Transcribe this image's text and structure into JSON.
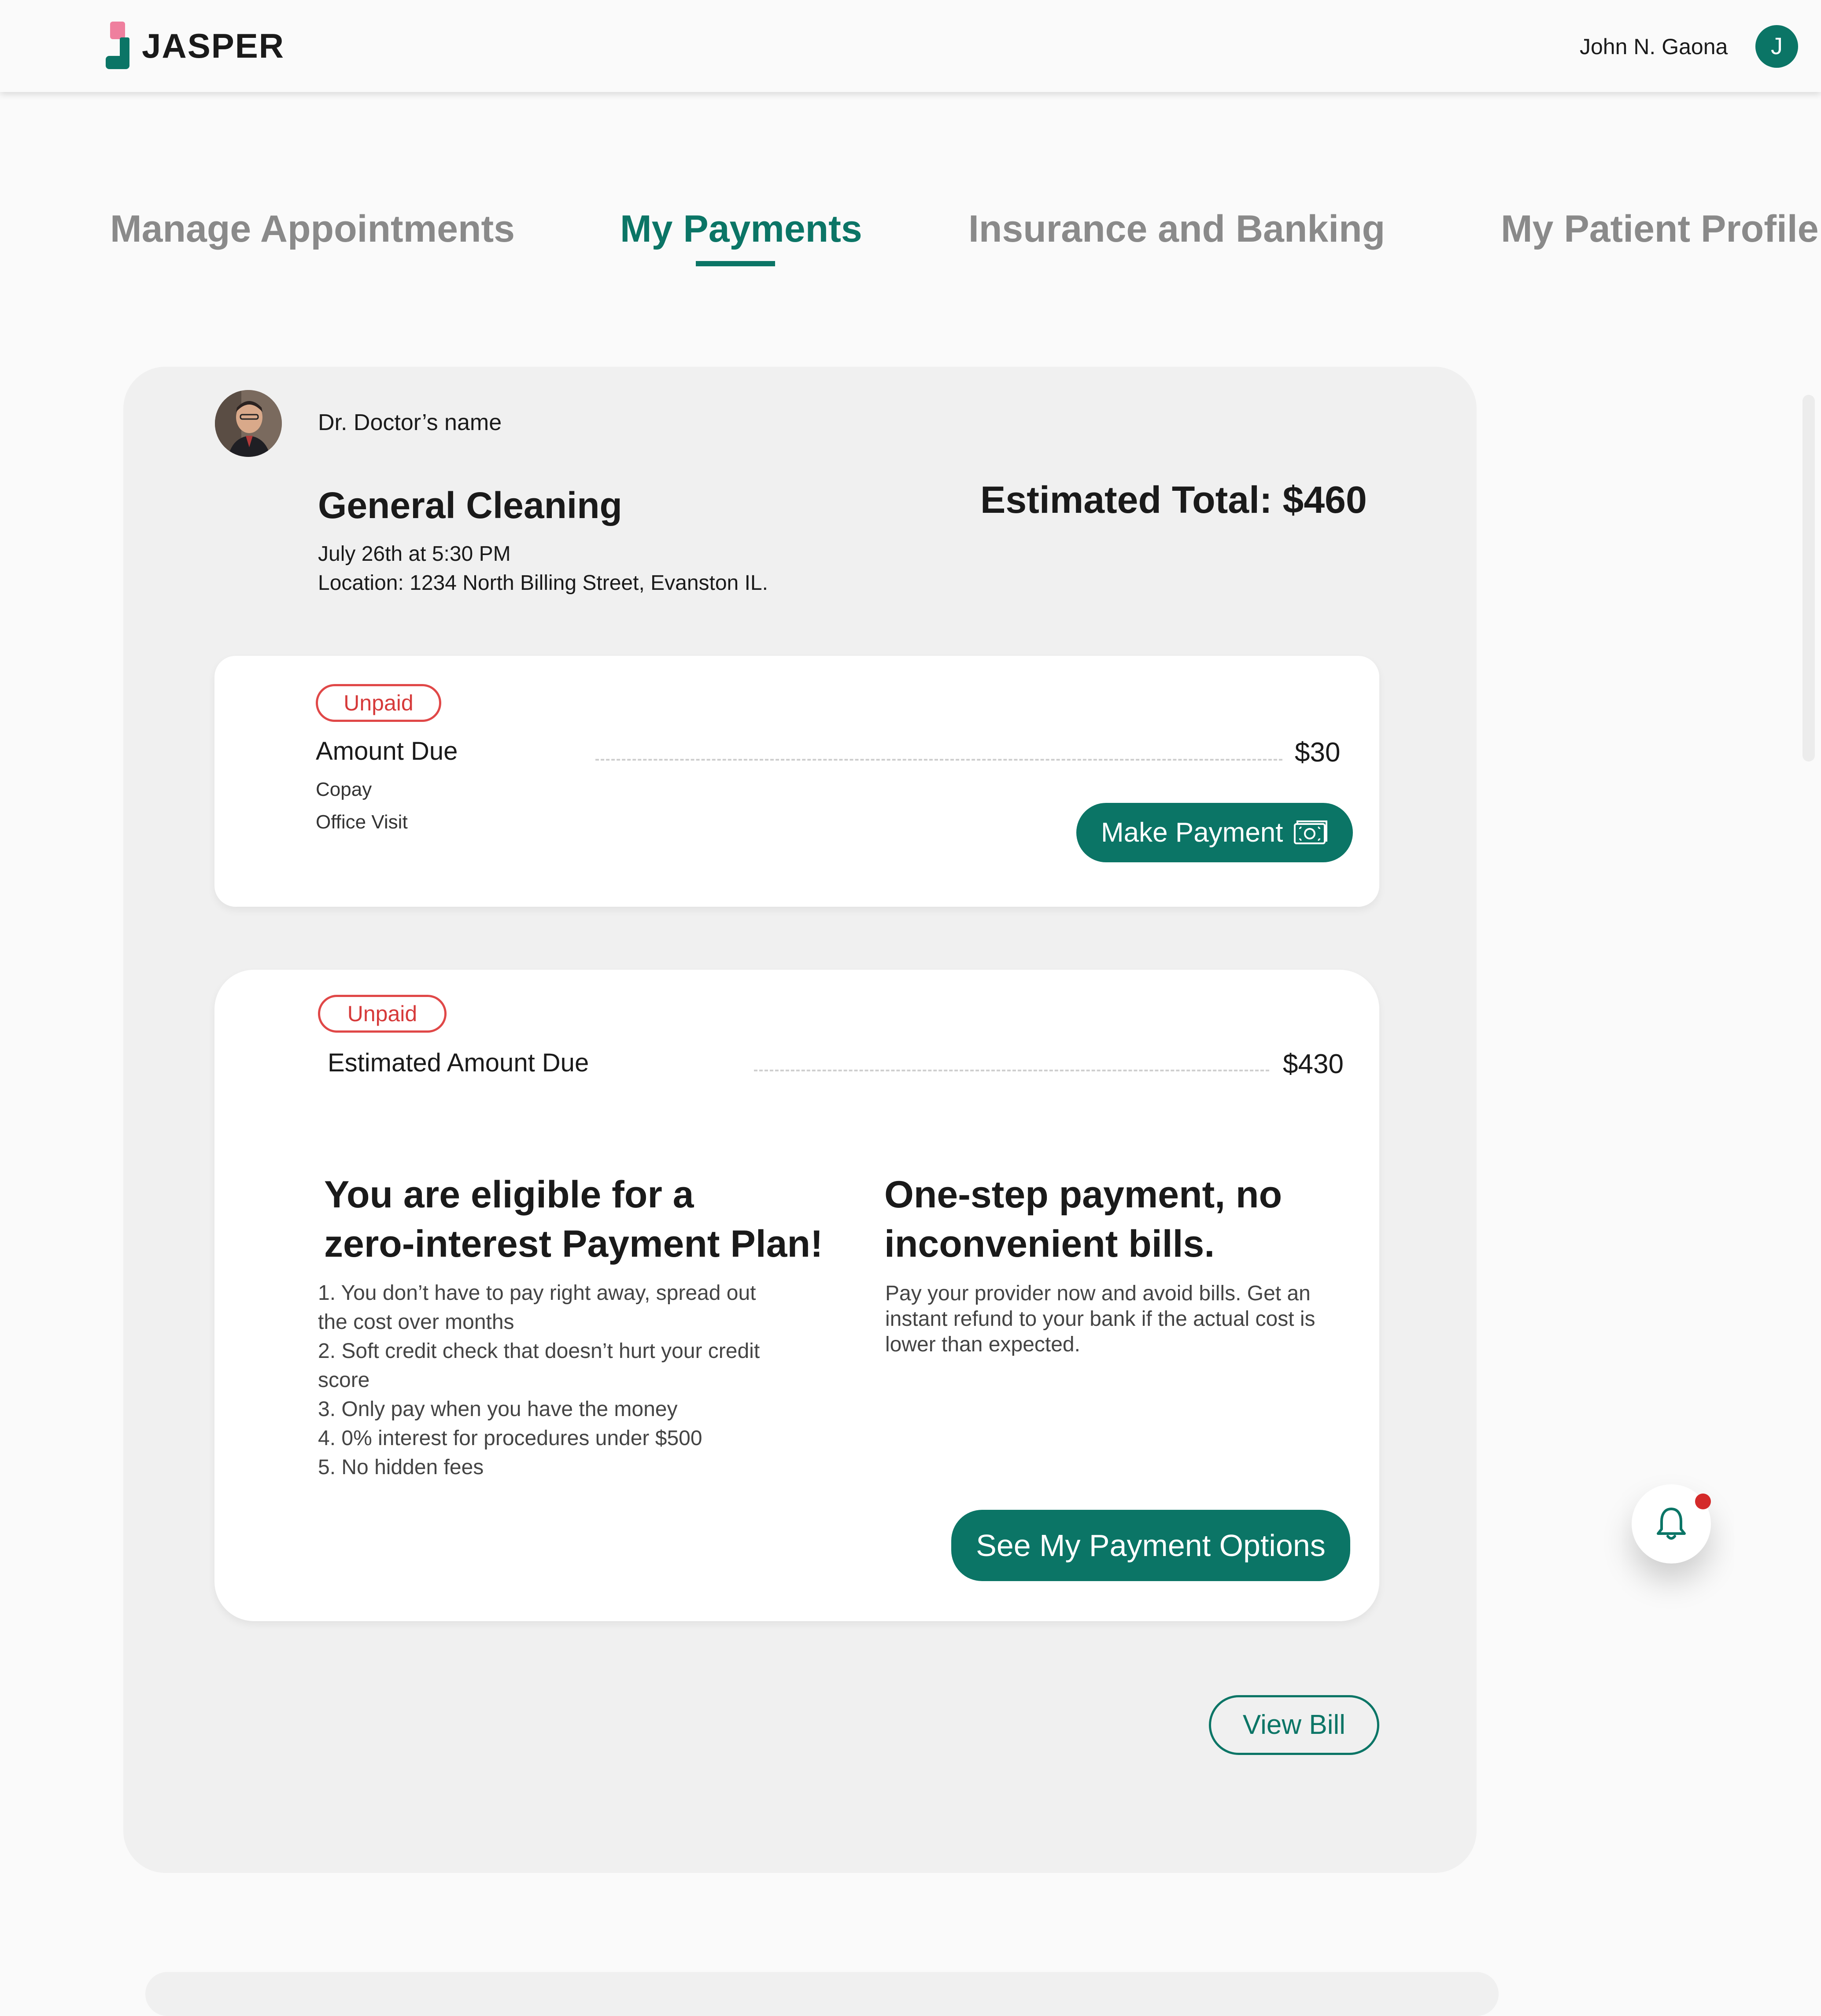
{
  "header": {
    "logo_text": "JASPER",
    "user_name": "John N. Gaona",
    "avatar_initial": "J"
  },
  "tabs": [
    {
      "label": "Manage Appointments",
      "active": false
    },
    {
      "label": "My Payments",
      "active": true
    },
    {
      "label": "Insurance and Banking",
      "active": false
    },
    {
      "label": "My Patient Profile",
      "active": false
    }
  ],
  "appointment": {
    "doctor_name": "Dr. Doctor’s name",
    "title": "General Cleaning",
    "estimated_total": "Estimated Total: $460",
    "time": "July 26th at 5:30 PM",
    "location": "Location: 1234 North Billing Street, Evanston IL."
  },
  "copay_card": {
    "status": "Unpaid",
    "label": "Amount Due",
    "amount": "$30",
    "sub1": "Copay",
    "sub2": "Office Visit",
    "button": "Make Payment"
  },
  "estimate_card": {
    "status": "Unpaid",
    "label": "Estimated Amount Due",
    "amount": "$430",
    "plan_heading_line1": "You are eligible for a",
    "plan_heading_line2": "zero-interest Payment Plan!",
    "plan_points": [
      "1.  You don’t have to pay right away, spread out",
      "the cost over months",
      "2. Soft credit check that doesn’t hurt your credit",
      "score",
      "3. Only pay when you have the money",
      "4. 0% interest for procedures under $500",
      "5. No hidden fees"
    ],
    "onestep_heading_line1": "One-step payment, no",
    "onestep_heading_line2": "inconvenient bills.",
    "onestep_body": [
      "Pay your provider now and avoid bills.  Get an",
      "instant refund to your bank if the actual cost is",
      "lower than expected."
    ],
    "button": "See My Payment Options"
  },
  "view_bill_button": "View Bill",
  "colors": {
    "brand_teal": "#0b7566",
    "unpaid_red": "#e04848",
    "logo_pink": "#ef7f9e",
    "notification_red": "#d42a2a"
  },
  "icons": {
    "logo": "jasper-logo-icon",
    "payment": "cash-icon",
    "notification": "bell-icon"
  }
}
